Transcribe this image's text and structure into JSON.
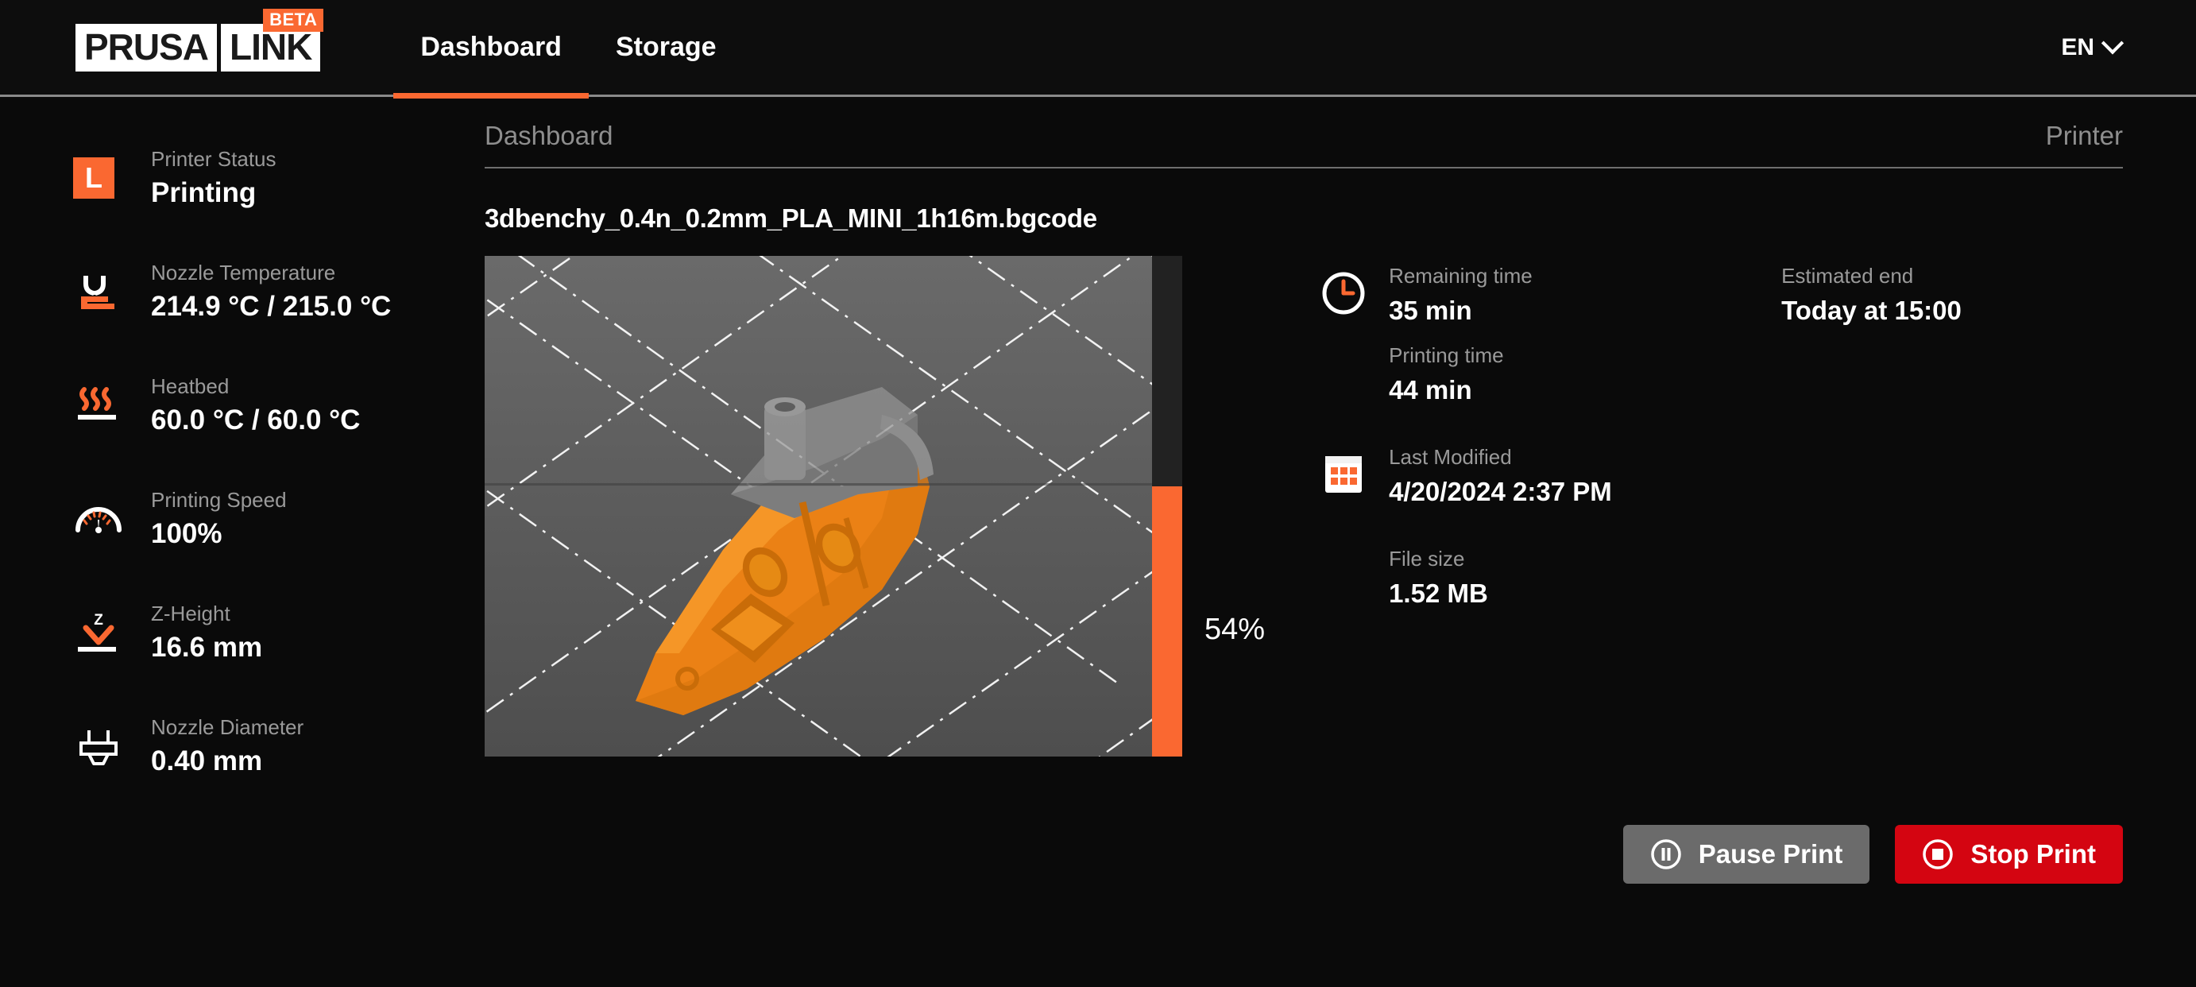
{
  "brand": {
    "word1": "PRUSA",
    "word2": "LINK",
    "beta": "BETA"
  },
  "nav": {
    "items": [
      {
        "label": "Dashboard",
        "active": true
      },
      {
        "label": "Storage",
        "active": false
      }
    ],
    "language": "EN"
  },
  "colors": {
    "accent": "#fa6831",
    "danger": "#d40511",
    "pause": "#6b6b6b",
    "background": "#0a0a0a",
    "muted_text": "#9a9a9a"
  },
  "sidebar": {
    "items": [
      {
        "icon": "printer-status-icon",
        "label": "Printer Status",
        "value": "Printing"
      },
      {
        "icon": "nozzle-temperature-icon",
        "label": "Nozzle Temperature",
        "value": "214.9 °C / 215.0 °C"
      },
      {
        "icon": "heatbed-icon",
        "label": "Heatbed",
        "value": "60.0 °C / 60.0 °C"
      },
      {
        "icon": "speed-gauge-icon",
        "label": "Printing Speed",
        "value": "100%"
      },
      {
        "icon": "z-height-icon",
        "label": "Z-Height",
        "value": "16.6 mm"
      },
      {
        "icon": "nozzle-diameter-icon",
        "label": "Nozzle Diameter",
        "value": "0.40 mm"
      }
    ]
  },
  "main": {
    "breadcrumb": "Dashboard",
    "breadcrumb_right": "Printer",
    "filename": "3dbenchy_0.4n_0.2mm_PLA_MINI_1h16m.bgcode",
    "progress": {
      "percent_label": "54%",
      "percent": 54
    },
    "info": {
      "remaining_time": {
        "label": "Remaining time",
        "value": "35 min",
        "icon": "clock-icon"
      },
      "estimated_end": {
        "label": "Estimated end",
        "value": "Today at 15:00"
      },
      "printing_time": {
        "label": "Printing time",
        "value": "44 min"
      },
      "last_modified": {
        "label": "Last Modified",
        "value": "4/20/2024 2:37 PM",
        "icon": "calendar-icon"
      },
      "file_size": {
        "label": "File size",
        "value": "1.52 MB"
      }
    },
    "actions": {
      "pause": {
        "label": "Pause Print",
        "icon": "pause-icon"
      },
      "stop": {
        "label": "Stop Print",
        "icon": "stop-icon"
      }
    }
  }
}
